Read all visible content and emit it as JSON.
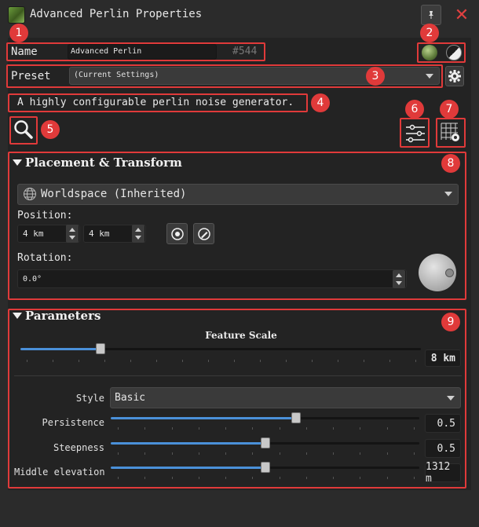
{
  "window": {
    "title": "Advanced Perlin Properties"
  },
  "name_row": {
    "label": "Name",
    "value": "Advanced Perlin",
    "id_text": "#544"
  },
  "preset": {
    "label": "Preset",
    "value": "(Current Settings)"
  },
  "description": "A highly configurable perlin noise generator.",
  "placement": {
    "title": "Placement & Transform",
    "space": "Worldspace (Inherited)",
    "position_label": "Position:",
    "position_x": "4 km",
    "position_y": "4 km",
    "rotation_label": "Rotation:",
    "rotation_value": "0.0°"
  },
  "parameters": {
    "title": "Parameters",
    "feature_scale": {
      "label": "Feature Scale",
      "value": "8 km",
      "level": 0.2
    },
    "style": {
      "label": "Style",
      "value": "Basic"
    },
    "sliders": [
      {
        "label": "Persistence",
        "value": "0.5",
        "level": 0.6
      },
      {
        "label": "Steepness",
        "value": "0.5",
        "level": 0.5
      },
      {
        "label": "Middle elevation",
        "value": "1312 m",
        "level": 0.5
      }
    ]
  },
  "badges": [
    "1",
    "2",
    "3",
    "4",
    "5",
    "6",
    "7",
    "8",
    "9"
  ],
  "colors": {
    "accent": "#4a90d9",
    "highlight": "#e03a3a",
    "close": "#e04040",
    "panel": "#232323",
    "window": "#2b2b2b"
  },
  "icons": [
    "app-terrain-icon",
    "pin-icon",
    "close-icon",
    "preview-sphere-icon",
    "light-mode-icon",
    "settings-gear-icon",
    "search-icon",
    "sliders-icon",
    "grid-settings-icon",
    "globe-icon",
    "target-icon",
    "eyedropper-icon",
    "rotation-knob"
  ]
}
